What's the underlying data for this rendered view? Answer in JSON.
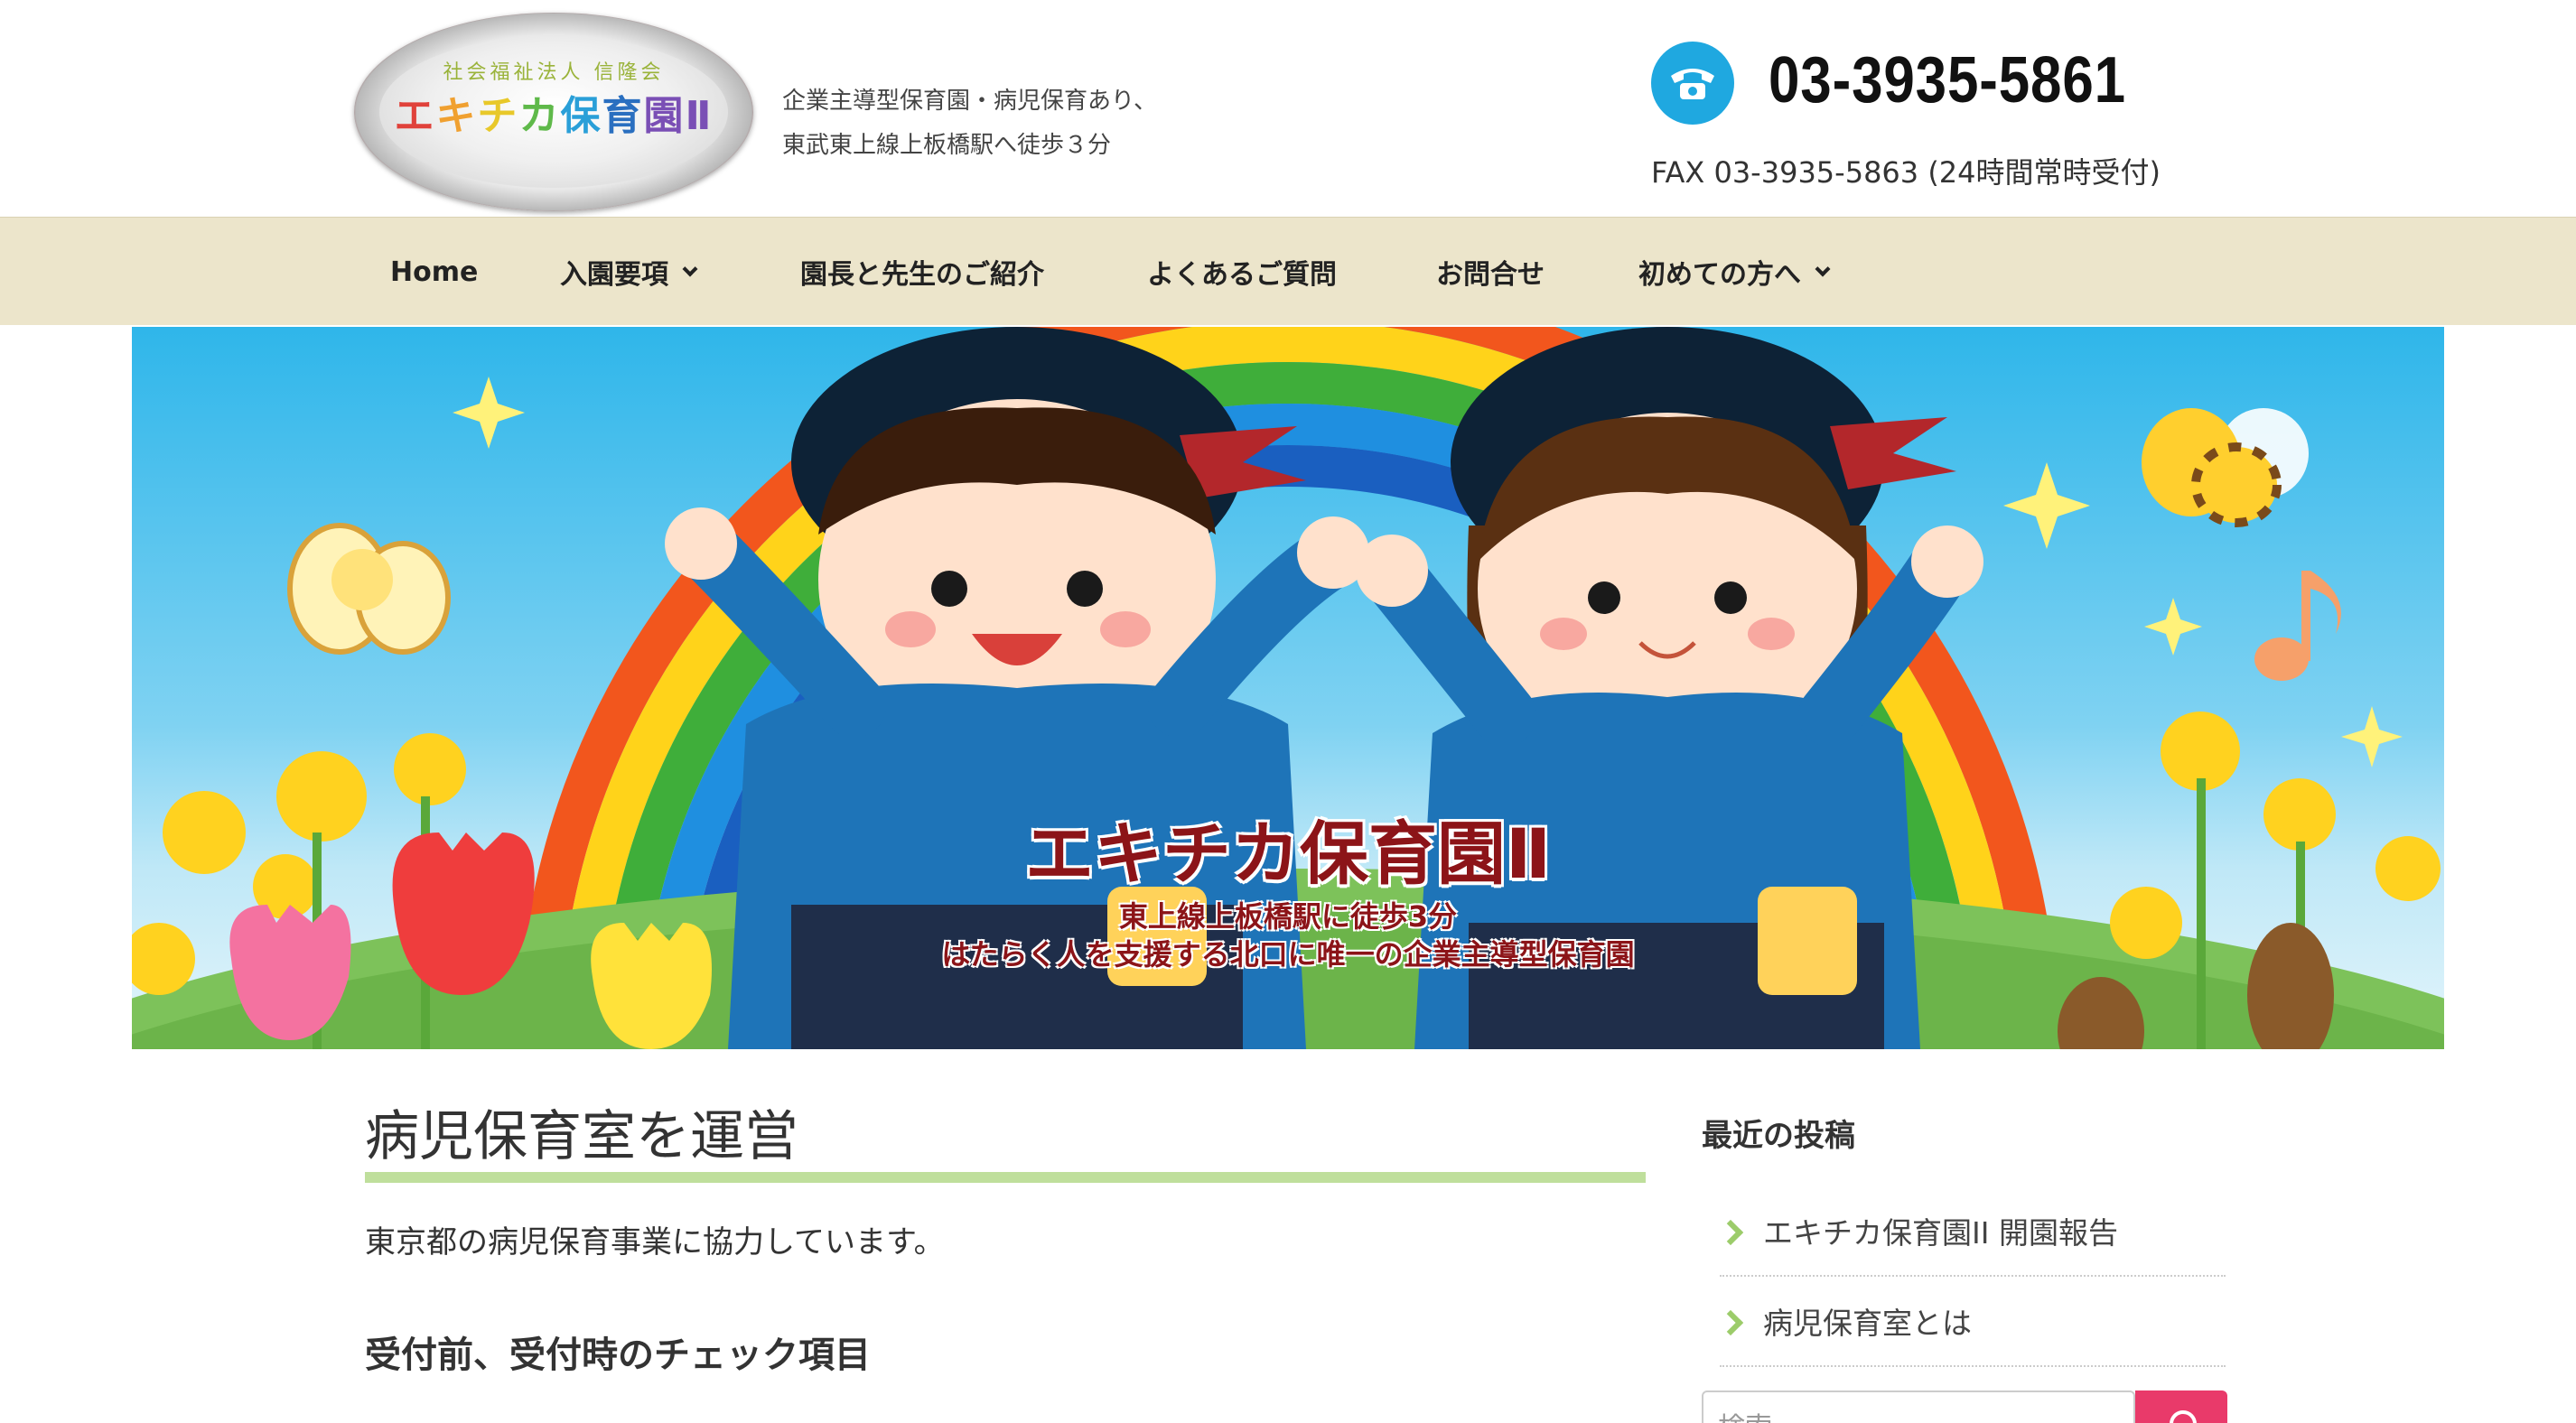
{
  "header": {
    "logo_subtitle": "社会福祉法人 信隆会",
    "logo_title_chars": [
      "エ",
      "キ",
      "チ",
      "カ",
      "保",
      "育",
      "園Ⅱ"
    ],
    "tagline": "企業主導型保育園・病児保育あり、東武東上線上板橋駅へ徒歩３分",
    "phone_icon": "phone-icon",
    "phone_number": "03-3935-5861",
    "fax": "FAX 03-3935-5863 (24時間常時受付)"
  },
  "nav": {
    "items": [
      {
        "label": "Home",
        "dropdown": false
      },
      {
        "label": "入園要項",
        "dropdown": true
      },
      {
        "label": "園長と先生のご紹介",
        "dropdown": false
      },
      {
        "label": "よくあるご質問",
        "dropdown": false
      },
      {
        "label": "お問合せ",
        "dropdown": false
      },
      {
        "label": "初めての方へ",
        "dropdown": true
      }
    ]
  },
  "hero": {
    "title": "エキチカ保育園Ⅱ",
    "line1": "東上線上板橋駅に徒歩3分",
    "line2": "はたらく人を支援する北口に唯一の企業主導型保育園"
  },
  "main": {
    "title": "病児保育室を運営",
    "intro": "東京都の病児保育事業に協力しています。",
    "section_heading": "受付前、受付時のチェック項目"
  },
  "sidebar": {
    "heading": "最近の投稿",
    "posts": [
      {
        "label": "エキチカ保育園II 開園報告"
      },
      {
        "label": "病児保育室とは"
      }
    ],
    "search_placeholder": "検索"
  },
  "colors": {
    "nav_bg": "#ece5cb",
    "phone_accent": "#1fa8e0",
    "title_underline": "#bfdf9c",
    "arrow": "#9ccc6a",
    "search_button": "#e93a6a"
  }
}
